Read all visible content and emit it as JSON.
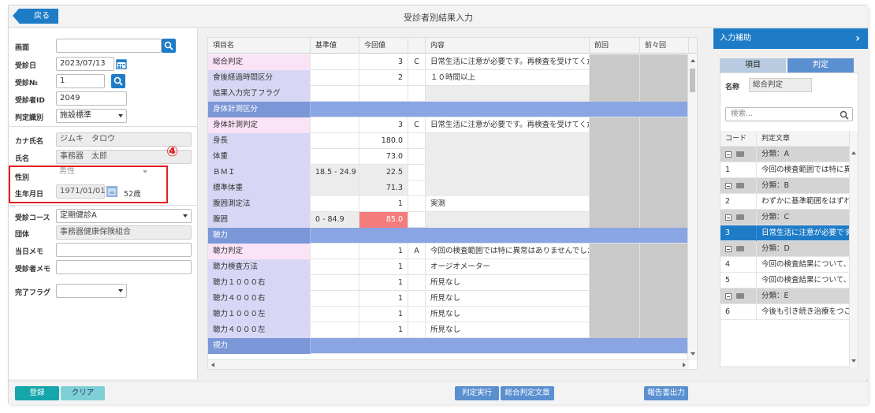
{
  "header": {
    "back_label": "戻る",
    "title": "受診者別結果入力"
  },
  "form": {
    "screen_label": "画面",
    "screen_value": "",
    "exam_date_label": "受診日",
    "exam_date_value": "2023/07/13",
    "exam_no_label": "受診№",
    "exam_no_value": "1",
    "patient_id_label": "受診者ID",
    "patient_id_value": "2049",
    "judge_type_label": "判定識別",
    "judge_type_value": "施設標準",
    "kana_label": "カナ氏名",
    "kana_value": "ジムキ　タロウ",
    "name_label": "氏名",
    "name_value": "事務器　太郎",
    "sex_label": "性別",
    "sex_value": "男性",
    "birth_label": "生年月日",
    "birth_value": "1971/01/01",
    "age_value": "52歳",
    "course_label": "受診コース",
    "course_value": "定期健診A",
    "org_label": "団体",
    "org_value": "事務器健康保険組合",
    "day_memo_label": "当日メモ",
    "day_memo_value": "",
    "patient_memo_label": "受診者メモ",
    "patient_memo_value": "",
    "complete_flag_label": "完了フラグ",
    "complete_flag_value": ""
  },
  "annotation": {
    "marker": "④"
  },
  "grid": {
    "headers": [
      "項目名",
      "基準値",
      "今回値",
      "",
      "内容",
      "前回",
      "前々回"
    ],
    "rows": [
      {
        "name": "総合判定",
        "base": "",
        "cur": "3",
        "code": "C",
        "content": "日常生活に注意が必要です。再検査を受けてくださ",
        "type": "pink"
      },
      {
        "name": "食後経過時間区分",
        "base": "",
        "cur": "2",
        "code": "",
        "content": "１０時間以上",
        "type": "normal"
      },
      {
        "name": "結果入力完了フラグ",
        "base": "",
        "cur": "",
        "code": "",
        "content": "",
        "type": "normal"
      },
      {
        "name": "身体計測区分",
        "type": "section"
      },
      {
        "name": "身体計測判定",
        "base": "",
        "cur": "3",
        "code": "C",
        "content": "日常生活に注意が必要です。再検査を受けてくださ",
        "type": "pink"
      },
      {
        "name": "身長",
        "base": "",
        "cur": "180.0",
        "code": "",
        "content": "",
        "type": "normal"
      },
      {
        "name": "体重",
        "base": "",
        "cur": "73.0",
        "code": "",
        "content": "",
        "type": "normal"
      },
      {
        "name": "ＢＭＩ",
        "base": "18.5 - 24.9",
        "cur": "22.5",
        "code": "",
        "content": "",
        "type": "calc"
      },
      {
        "name": "標準体重",
        "base": "",
        "cur": "71.3",
        "code": "",
        "content": "",
        "type": "calc"
      },
      {
        "name": "腹囲測定法",
        "base": "",
        "cur": "1",
        "code": "",
        "content": "実測",
        "type": "normal"
      },
      {
        "name": "腹囲",
        "base": "0 - 84.9",
        "cur": "85.0",
        "code": "",
        "content": "",
        "type": "abnormal"
      },
      {
        "name": "聴力",
        "type": "section"
      },
      {
        "name": "聴力判定",
        "base": "",
        "cur": "1",
        "code": "A",
        "content": "今回の検査範囲では特に異常はありませんでした。",
        "type": "pink"
      },
      {
        "name": "聴力検査方法",
        "base": "",
        "cur": "1",
        "code": "",
        "content": "オージオメーター",
        "type": "normal"
      },
      {
        "name": "聴力１０００右",
        "base": "",
        "cur": "1",
        "code": "",
        "content": "所見なし",
        "type": "normal"
      },
      {
        "name": "聴力４０００右",
        "base": "",
        "cur": "1",
        "code": "",
        "content": "所見なし",
        "type": "normal"
      },
      {
        "name": "聴力１０００左",
        "base": "",
        "cur": "1",
        "code": "",
        "content": "所見なし",
        "type": "normal"
      },
      {
        "name": "聴力４０００左",
        "base": "",
        "cur": "1",
        "code": "",
        "content": "所見なし",
        "type": "normal"
      },
      {
        "name": "視力",
        "type": "section"
      }
    ]
  },
  "right_panel": {
    "title": "入力補助",
    "tab_item": "項目",
    "tab_judge": "判定",
    "name_label": "名称",
    "name_value": "総合判定",
    "search_placeholder": "検索...",
    "col_code": "コード",
    "col_text": "判定文章",
    "list": [
      {
        "code": "",
        "text": "分類：A",
        "kind": "group"
      },
      {
        "code": "1",
        "text": "今回の検査範囲では特に異",
        "kind": "item"
      },
      {
        "code": "",
        "text": "分類：B",
        "kind": "group"
      },
      {
        "code": "2",
        "text": "わずかに基準範囲をはずれ",
        "kind": "item"
      },
      {
        "code": "",
        "text": "分類：C",
        "kind": "group"
      },
      {
        "code": "3",
        "text": "日常生活に注意が必要です",
        "kind": "sel"
      },
      {
        "code": "",
        "text": "分類：D",
        "kind": "group"
      },
      {
        "code": "4",
        "text": "今回の検査結果について、",
        "kind": "item"
      },
      {
        "code": "5",
        "text": "今回の検査結果について、",
        "kind": "item"
      },
      {
        "code": "",
        "text": "分類：E",
        "kind": "group"
      },
      {
        "code": "6",
        "text": "今後も引き続き治療をつこ",
        "kind": "item"
      }
    ]
  },
  "footer": {
    "register": "登録",
    "clear": "クリア",
    "judge_exec": "判定実行",
    "overall_text": "総合判定文章",
    "report_out": "報告書出力"
  }
}
